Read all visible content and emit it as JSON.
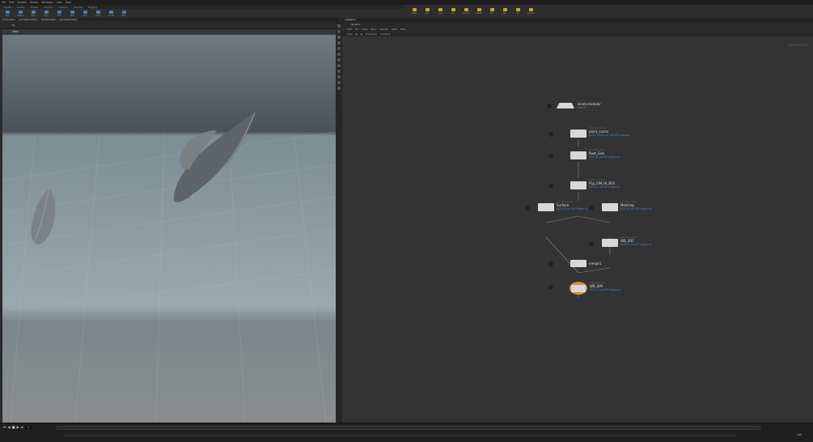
{
  "menubar": {
    "items": [
      "File",
      "Edit",
      "Render",
      "Assets",
      "Windows",
      "Labs",
      "Help"
    ]
  },
  "shelf": {
    "tabs": [
      "Create",
      "Modify",
      "Model",
      "Polygon",
      "Deform",
      "Texture",
      "Rigging"
    ],
    "tools": [
      "Box",
      "Sphere",
      "Tube",
      "Torus",
      "Grid",
      "Null",
      "Line",
      "Circle",
      "Curve",
      "Path",
      "Spray Paint",
      "Font"
    ]
  },
  "right_shelf": {
    "tools": [
      "Lights",
      "Spot",
      "Area",
      "Geo",
      "Volume",
      "Distant",
      "Env",
      "Sky",
      "GI",
      "Caustic",
      "Portal",
      "Camera"
    ]
  },
  "viewport": {
    "tabs": [
      "Scene View",
      "Animation Editor",
      "Render View",
      "Composite View"
    ],
    "title": "View",
    "path": "obj"
  },
  "network": {
    "tabs": [
      "/obj/geo1"
    ],
    "path": "obj  geo1",
    "menu": [
      "Edit",
      "Go",
      "View",
      "Tools",
      "Layout",
      "Labs",
      "Help"
    ],
    "status": [
      "Cook",
      "Processing",
      "0 cooking"
    ],
    "watermark": "Geometry",
    "nodes": [
      {
        "id": "localscheduler",
        "label": "localscheduler",
        "sub": "topnet",
        "type": ""
      },
      {
        "id": "point_cache",
        "label": "point_cache",
        "sub": "point_cache_s1_w0.$F4.bgeo.sc",
        "type": "Labs File Cache"
      },
      {
        "id": "float_geo",
        "label": "float_Geo",
        "sub": "$OS_s1_w0.$F4.bgeo.sc",
        "type": "Labs File Cache"
      },
      {
        "id": "flip_sim",
        "label": "Flip_SIM_HI_RES",
        "sub": "$OS_s1_w0.$F4.bgeo.sc",
        "type": "Labs File Cache"
      },
      {
        "id": "surface",
        "label": "Surface",
        "sub": "$OS_s1_w0.$F4.bgeo.sc",
        "type": "Labs File Cache"
      },
      {
        "id": "meshing",
        "label": "Meshing",
        "sub": "$OS_s1_w0.$F4.bgeo.sc",
        "type": "Labs File Cache"
      },
      {
        "id": "wb_src",
        "label": "WB_SRC",
        "sub": "$OS_s1_w0.$F4.bgeo.sc",
        "type": "Labs File Cache"
      },
      {
        "id": "merge1",
        "label": "merge1",
        "sub": "",
        "type": ""
      },
      {
        "id": "wb_sim",
        "label": "WB_SIM",
        "sub": "$OS_s1_w0.$F4.bgeo.sc",
        "type": "Labs File Cache"
      }
    ]
  },
  "timeline": {
    "frame": "1",
    "end_frame": "240"
  },
  "colors": {
    "node_selected": "#c8963a",
    "link": "#4f86c6"
  }
}
